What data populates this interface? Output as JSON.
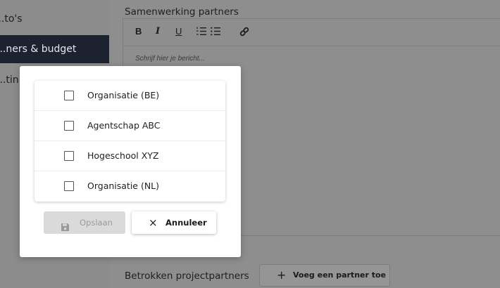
{
  "sidebar": {
    "items": [
      {
        "label": "...to's"
      },
      {
        "label": "...ners & budget"
      },
      {
        "label": "...tin"
      }
    ]
  },
  "main": {
    "section_title": "Samenwerking partners",
    "editor": {
      "toolbar": {
        "bold": "B",
        "italic": "I",
        "underline": "U",
        "ordered_list": "☰",
        "bullet_list": "☰",
        "link": "🔗"
      },
      "placeholder": "Schrijf hier je bericht..."
    },
    "partners_label": "Betrokken projectpartners",
    "add_partner_button": {
      "icon": "+",
      "label": "Voeg een partner toe"
    }
  },
  "modal": {
    "options": [
      {
        "label": "Organisatie (BE)",
        "checked": false
      },
      {
        "label": "Agentschap ABC",
        "checked": false
      },
      {
        "label": "Hogeschool XYZ",
        "checked": false
      },
      {
        "label": "Organisatie (NL)",
        "checked": false
      }
    ],
    "save_button": {
      "label": "Opslaan",
      "icon": "save-icon",
      "disabled": true
    },
    "cancel_button": {
      "label": "Annuleer",
      "icon": "×"
    }
  }
}
